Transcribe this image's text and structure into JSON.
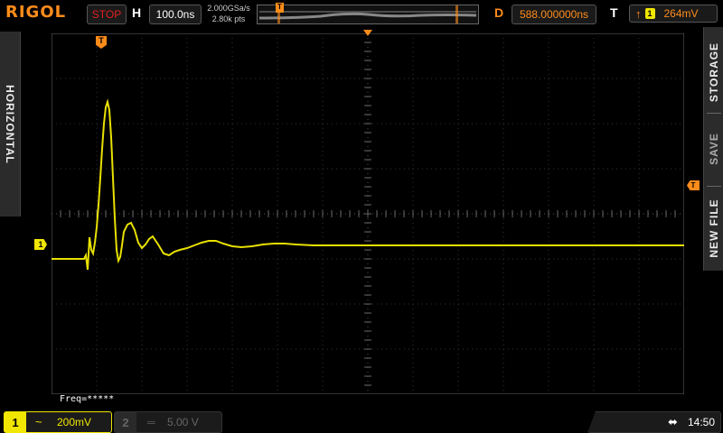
{
  "brand": "RIGOL",
  "run_state": "STOP",
  "horizontal": {
    "label": "H",
    "timebase": "100.0ns",
    "sample_rate": "2.000GSa/s",
    "points": "2.80k pts"
  },
  "delay": {
    "label": "D",
    "value": "588.000000ns"
  },
  "trigger": {
    "label": "T",
    "edge_icon": "rising-edge-icon",
    "source": "1",
    "level": "264mV",
    "marker": "T"
  },
  "left_tab": "HORIZONTAL",
  "right_menu": {
    "items": [
      "STORAGE",
      "SAVE",
      "NEW FILE"
    ]
  },
  "freq_readout": "Freq=*****",
  "channel1": {
    "number": "1",
    "coupling": "~",
    "scale": "200mV",
    "marker": "1",
    "color": "#f0e600"
  },
  "channel2": {
    "number": "2",
    "coupling": "═",
    "scale": "5.00 V"
  },
  "system": {
    "usb_icon": "usb-icon",
    "time": "14:50"
  },
  "colors": {
    "accent": "#ff8c1a",
    "ch1": "#f0e600",
    "stop": "#e02020"
  }
}
